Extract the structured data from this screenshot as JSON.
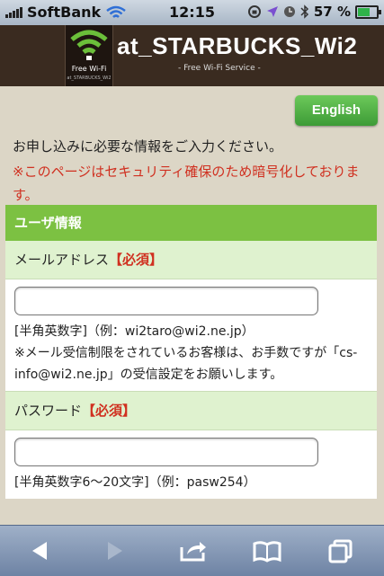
{
  "status_bar": {
    "carrier": "SoftBank",
    "time": "12:15",
    "battery": "57 %",
    "battery_level": 0.57
  },
  "banner": {
    "logo_label": "Free Wi-Fi",
    "logo_sublabel": "at_STARBUCKS_Wi2",
    "title": "at_STARBUCKS_Wi2",
    "subtitle": "- Free Wi-Fi Service -"
  },
  "english_button": "English",
  "intro_text": "お申し込みに必要な情報をご入力ください。",
  "security_notice": "※このページはセキュリティ確保のため暗号化しております。",
  "form": {
    "section_title": "ユーザ情報",
    "email": {
      "label": "メールアドレス",
      "required": "【必須】",
      "value": "",
      "hint": "[半角英数字]（例：wi2taro@wi2.ne.jp）",
      "note": "※メール受信制限をされているお客様は、お手数ですが「cs-info@wi2.ne.jp」の受信設定をお願いします。"
    },
    "password": {
      "label": "パスワード",
      "required": "【必須】",
      "value": "",
      "hint": "[半角英数字6～20文字]（例：pasw254）"
    }
  },
  "colors": {
    "header_green": "#7cc142",
    "label_green": "#dff2cf",
    "warning_red": "#d03020",
    "banner_brown": "#3a2b20",
    "page_bg": "#dcd6c6"
  },
  "toolbar_icons": [
    "back-icon",
    "forward-icon",
    "share-icon",
    "bookmarks-icon",
    "tabs-icon"
  ]
}
